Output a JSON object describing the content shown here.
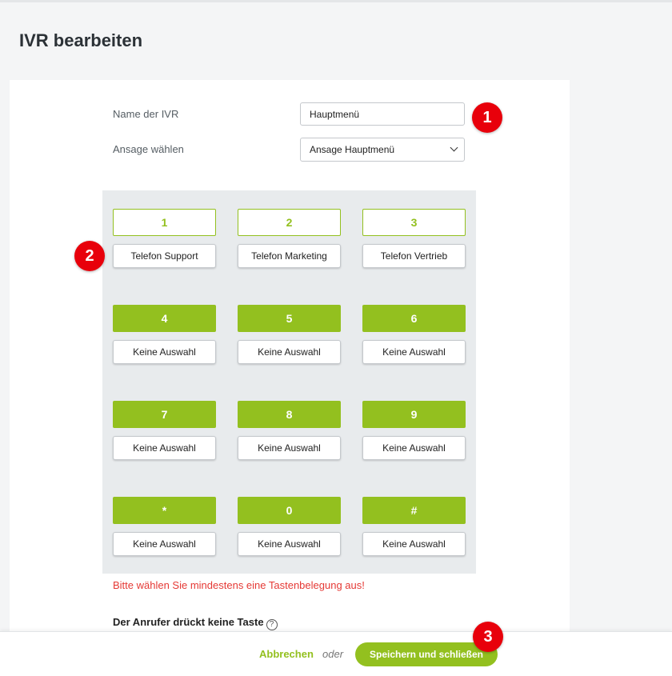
{
  "page": {
    "title": "IVR bearbeiten"
  },
  "form": {
    "name_label": "Name der IVR",
    "name_value": "Hauptmenü",
    "announcement_label": "Ansage wählen",
    "announcement_value": "Ansage Hauptmenü"
  },
  "keypad": {
    "keys": [
      {
        "key": "1",
        "assignment": "Telefon Support",
        "style": "outline"
      },
      {
        "key": "2",
        "assignment": "Telefon Marketing",
        "style": "outline"
      },
      {
        "key": "3",
        "assignment": "Telefon Vertrieb",
        "style": "outline"
      },
      {
        "key": "4",
        "assignment": "Keine Auswahl",
        "style": "filled"
      },
      {
        "key": "5",
        "assignment": "Keine Auswahl",
        "style": "filled"
      },
      {
        "key": "6",
        "assignment": "Keine Auswahl",
        "style": "filled"
      },
      {
        "key": "7",
        "assignment": "Keine Auswahl",
        "style": "filled"
      },
      {
        "key": "8",
        "assignment": "Keine Auswahl",
        "style": "filled"
      },
      {
        "key": "9",
        "assignment": "Keine Auswahl",
        "style": "filled"
      },
      {
        "key": "*",
        "assignment": "Keine Auswahl",
        "style": "filled"
      },
      {
        "key": "0",
        "assignment": "Keine Auswahl",
        "style": "filled"
      },
      {
        "key": "#",
        "assignment": "Keine Auswahl",
        "style": "filled"
      }
    ]
  },
  "error": "Bitte wählen Sie mindestens eine Tastenbelegung aus!",
  "no_key": {
    "label": "Der Anrufer drückt keine Taste",
    "help_icon": "question-circle-icon",
    "help_glyph": "?"
  },
  "footer": {
    "cancel_label": "Abbrechen",
    "or_label": "oder",
    "save_label": "Speichern und schließen"
  },
  "markers": [
    "1",
    "2",
    "3"
  ],
  "colors": {
    "accent": "#93c01f",
    "error": "#e53935",
    "marker": "#e8000b",
    "keypad_bg": "#e8ebed"
  }
}
